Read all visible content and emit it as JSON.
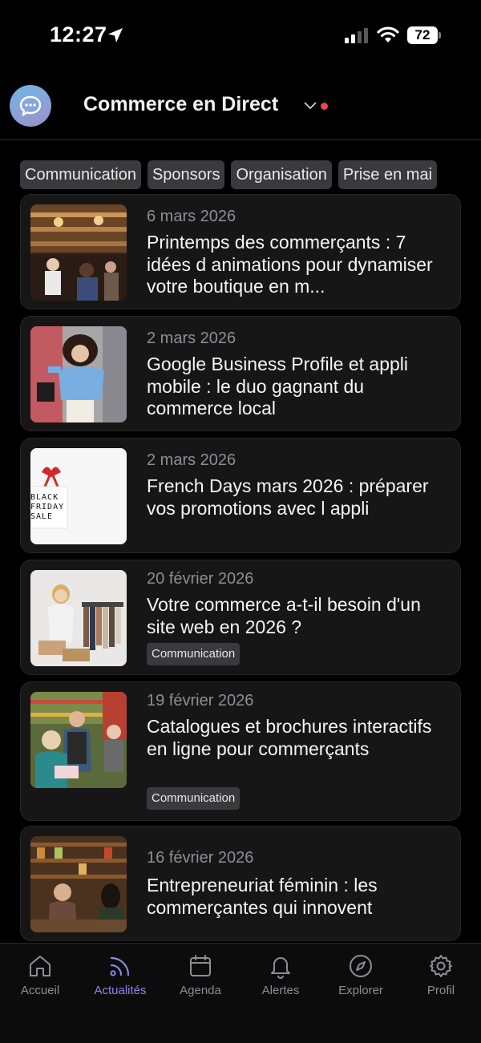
{
  "status": {
    "time": "12:27",
    "battery": "72"
  },
  "header": {
    "title": "Commerce en Direct"
  },
  "chips": [
    "Communication",
    "Sponsors",
    "Organisation",
    "Prise en mai"
  ],
  "articles": [
    {
      "date": "6 mars 2026",
      "title": "Printemps des commerçants : 7 idées d animations pour dynamiser votre boutique en m...",
      "tag": ""
    },
    {
      "date": "2 mars 2026",
      "title": "Google Business Profile et appli mobile : le duo gagnant du commerce local",
      "tag": ""
    },
    {
      "date": "2 mars 2026",
      "title": "French Days mars 2026 : préparer vos promotions avec l appli",
      "tag": "",
      "image_text": "BLACK FRIDAY SALE"
    },
    {
      "date": "20 février 2026",
      "title": "Votre commerce a-t-il besoin d'un site web en 2026 ?",
      "tag": "Communication"
    },
    {
      "date": "19 février 2026",
      "title": "Catalogues et brochures interactifs en ligne pour commerçants",
      "tag": "Communication"
    },
    {
      "date": "16 février 2026",
      "title": "Entrepreneuriat féminin : les commerçantes qui innovent",
      "tag": ""
    }
  ],
  "nav": [
    {
      "label": "Accueil",
      "icon": "home-icon"
    },
    {
      "label": "Actualités",
      "icon": "rss-icon",
      "active": true
    },
    {
      "label": "Agenda",
      "icon": "calendar-icon"
    },
    {
      "label": "Alertes",
      "icon": "bell-icon"
    },
    {
      "label": "Explorer",
      "icon": "compass-icon"
    },
    {
      "label": "Profil",
      "icon": "gear-icon"
    }
  ],
  "colors": {
    "accent": "#8e86e8",
    "notification_dot": "#e8484f",
    "background": "#000000",
    "card": "#161616"
  }
}
